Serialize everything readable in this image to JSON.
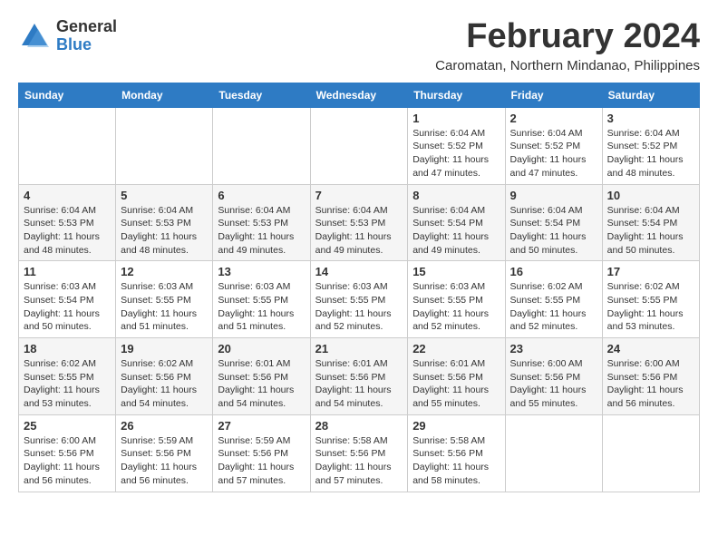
{
  "header": {
    "logo_general": "General",
    "logo_blue": "Blue",
    "month_title": "February 2024",
    "location": "Caromatan, Northern Mindanao, Philippines"
  },
  "weekdays": [
    "Sunday",
    "Monday",
    "Tuesday",
    "Wednesday",
    "Thursday",
    "Friday",
    "Saturday"
  ],
  "weeks": [
    [
      {
        "day": "",
        "content": ""
      },
      {
        "day": "",
        "content": ""
      },
      {
        "day": "",
        "content": ""
      },
      {
        "day": "",
        "content": ""
      },
      {
        "day": "1",
        "content": "Sunrise: 6:04 AM\nSunset: 5:52 PM\nDaylight: 11 hours and 47 minutes."
      },
      {
        "day": "2",
        "content": "Sunrise: 6:04 AM\nSunset: 5:52 PM\nDaylight: 11 hours and 47 minutes."
      },
      {
        "day": "3",
        "content": "Sunrise: 6:04 AM\nSunset: 5:52 PM\nDaylight: 11 hours and 48 minutes."
      }
    ],
    [
      {
        "day": "4",
        "content": "Sunrise: 6:04 AM\nSunset: 5:53 PM\nDaylight: 11 hours and 48 minutes."
      },
      {
        "day": "5",
        "content": "Sunrise: 6:04 AM\nSunset: 5:53 PM\nDaylight: 11 hours and 48 minutes."
      },
      {
        "day": "6",
        "content": "Sunrise: 6:04 AM\nSunset: 5:53 PM\nDaylight: 11 hours and 49 minutes."
      },
      {
        "day": "7",
        "content": "Sunrise: 6:04 AM\nSunset: 5:53 PM\nDaylight: 11 hours and 49 minutes."
      },
      {
        "day": "8",
        "content": "Sunrise: 6:04 AM\nSunset: 5:54 PM\nDaylight: 11 hours and 49 minutes."
      },
      {
        "day": "9",
        "content": "Sunrise: 6:04 AM\nSunset: 5:54 PM\nDaylight: 11 hours and 50 minutes."
      },
      {
        "day": "10",
        "content": "Sunrise: 6:04 AM\nSunset: 5:54 PM\nDaylight: 11 hours and 50 minutes."
      }
    ],
    [
      {
        "day": "11",
        "content": "Sunrise: 6:03 AM\nSunset: 5:54 PM\nDaylight: 11 hours and 50 minutes."
      },
      {
        "day": "12",
        "content": "Sunrise: 6:03 AM\nSunset: 5:55 PM\nDaylight: 11 hours and 51 minutes."
      },
      {
        "day": "13",
        "content": "Sunrise: 6:03 AM\nSunset: 5:55 PM\nDaylight: 11 hours and 51 minutes."
      },
      {
        "day": "14",
        "content": "Sunrise: 6:03 AM\nSunset: 5:55 PM\nDaylight: 11 hours and 52 minutes."
      },
      {
        "day": "15",
        "content": "Sunrise: 6:03 AM\nSunset: 5:55 PM\nDaylight: 11 hours and 52 minutes."
      },
      {
        "day": "16",
        "content": "Sunrise: 6:02 AM\nSunset: 5:55 PM\nDaylight: 11 hours and 52 minutes."
      },
      {
        "day": "17",
        "content": "Sunrise: 6:02 AM\nSunset: 5:55 PM\nDaylight: 11 hours and 53 minutes."
      }
    ],
    [
      {
        "day": "18",
        "content": "Sunrise: 6:02 AM\nSunset: 5:55 PM\nDaylight: 11 hours and 53 minutes."
      },
      {
        "day": "19",
        "content": "Sunrise: 6:02 AM\nSunset: 5:56 PM\nDaylight: 11 hours and 54 minutes."
      },
      {
        "day": "20",
        "content": "Sunrise: 6:01 AM\nSunset: 5:56 PM\nDaylight: 11 hours and 54 minutes."
      },
      {
        "day": "21",
        "content": "Sunrise: 6:01 AM\nSunset: 5:56 PM\nDaylight: 11 hours and 54 minutes."
      },
      {
        "day": "22",
        "content": "Sunrise: 6:01 AM\nSunset: 5:56 PM\nDaylight: 11 hours and 55 minutes."
      },
      {
        "day": "23",
        "content": "Sunrise: 6:00 AM\nSunset: 5:56 PM\nDaylight: 11 hours and 55 minutes."
      },
      {
        "day": "24",
        "content": "Sunrise: 6:00 AM\nSunset: 5:56 PM\nDaylight: 11 hours and 56 minutes."
      }
    ],
    [
      {
        "day": "25",
        "content": "Sunrise: 6:00 AM\nSunset: 5:56 PM\nDaylight: 11 hours and 56 minutes."
      },
      {
        "day": "26",
        "content": "Sunrise: 5:59 AM\nSunset: 5:56 PM\nDaylight: 11 hours and 56 minutes."
      },
      {
        "day": "27",
        "content": "Sunrise: 5:59 AM\nSunset: 5:56 PM\nDaylight: 11 hours and 57 minutes."
      },
      {
        "day": "28",
        "content": "Sunrise: 5:58 AM\nSunset: 5:56 PM\nDaylight: 11 hours and 57 minutes."
      },
      {
        "day": "29",
        "content": "Sunrise: 5:58 AM\nSunset: 5:56 PM\nDaylight: 11 hours and 58 minutes."
      },
      {
        "day": "",
        "content": ""
      },
      {
        "day": "",
        "content": ""
      }
    ]
  ]
}
